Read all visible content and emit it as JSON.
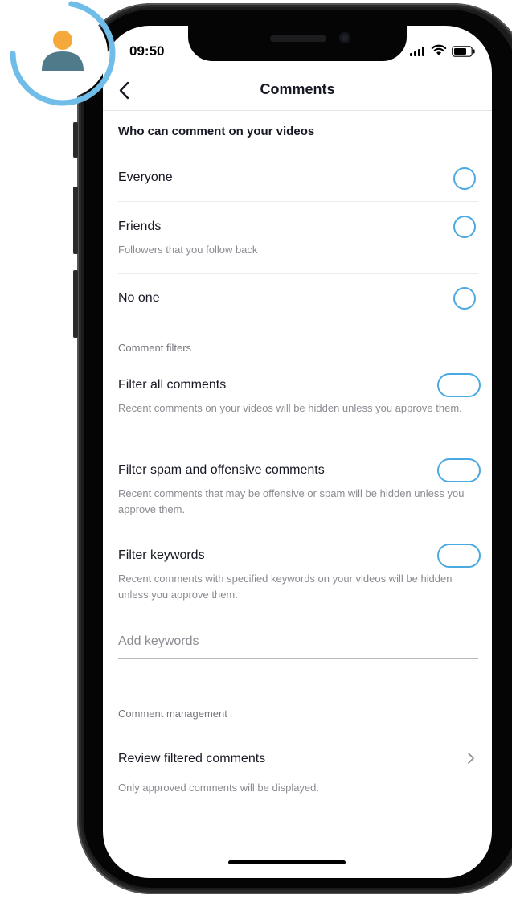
{
  "status_bar": {
    "time": "09:50"
  },
  "nav": {
    "title": "Comments",
    "back_icon": "chevron-left-icon"
  },
  "who_can_comment": {
    "heading": "Who can comment on your videos",
    "options": [
      {
        "label": "Everyone",
        "sublabel": "",
        "selected": false
      },
      {
        "label": "Friends",
        "sublabel": "Followers that you follow back",
        "selected": false
      },
      {
        "label": "No one",
        "sublabel": "",
        "selected": false
      }
    ]
  },
  "comment_filters": {
    "heading": "Comment filters",
    "filters": [
      {
        "label": "Filter all comments",
        "description": "Recent comments on your videos will be hidden unless you approve them.",
        "enabled": false
      },
      {
        "label": "Filter spam and offensive comments",
        "description": "Recent comments that may be offensive or spam will be hidden unless you approve them.",
        "enabled": false
      },
      {
        "label": "Filter keywords",
        "description": "Recent comments with specified keywords on your videos will be hidden unless you approve them.",
        "enabled": false
      }
    ],
    "keywords_input": {
      "value": "",
      "placeholder": "Add keywords"
    }
  },
  "comment_management": {
    "heading": "Comment management",
    "review_label": "Review filtered comments",
    "review_description": "Only approved comments will be displayed."
  },
  "colors": {
    "accent": "#4aa9e0",
    "text_primary": "#161823",
    "text_secondary": "#8a8b91",
    "avatar_head": "#f5a93a",
    "avatar_body": "#4f7a8a",
    "progress_ring": "#6fbde8"
  },
  "avatar_overlay": {
    "icon": "user-avatar-icon",
    "progress_ring_fraction": 0.72
  }
}
